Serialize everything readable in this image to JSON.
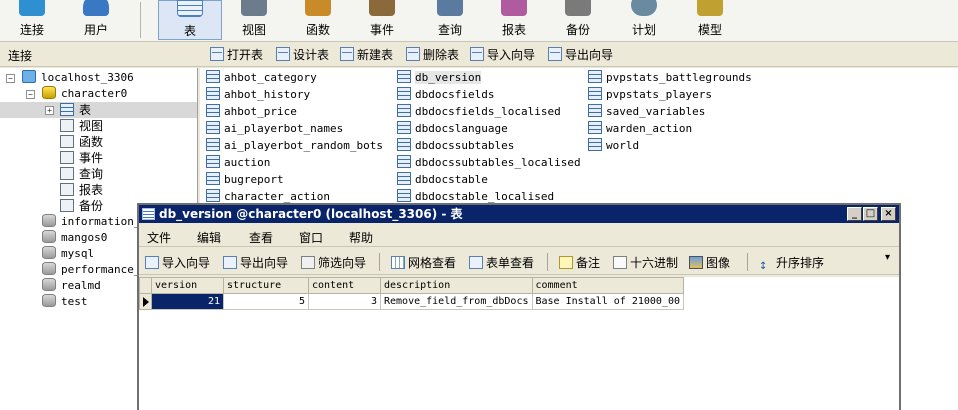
{
  "toolbar": {
    "buttons": [
      {
        "label": "连接",
        "icon": "connect-icon",
        "color": "#2f8fd0"
      },
      {
        "label": "用户",
        "icon": "user-icon",
        "color": "#3a78c4"
      },
      {
        "label": "表",
        "icon": "table-icon",
        "color": "#4a7fc0",
        "active": true
      },
      {
        "label": "视图",
        "icon": "view-icon",
        "color": "#6d7c8c"
      },
      {
        "label": "函数",
        "icon": "function-icon",
        "color": "#c98a2a"
      },
      {
        "label": "事件",
        "icon": "event-icon",
        "color": "#8a6a3a"
      },
      {
        "label": "查询",
        "icon": "query-icon",
        "color": "#5a7aa0"
      },
      {
        "label": "报表",
        "icon": "report-icon",
        "color": "#b05aa0"
      },
      {
        "label": "备份",
        "icon": "backup-icon",
        "color": "#7a7a7a"
      },
      {
        "label": "计划",
        "icon": "schedule-icon",
        "color": "#6a8aa0"
      },
      {
        "label": "模型",
        "icon": "model-icon",
        "color": "#c0a030"
      }
    ]
  },
  "subbar": {
    "connection_label": "连接",
    "actions": [
      "打开表",
      "设计表",
      "新建表",
      "删除表",
      "导入向导",
      "导出向导"
    ]
  },
  "tree": {
    "host": "localhost_3306",
    "open_db": "character0",
    "categories": [
      "表",
      "视图",
      "函数",
      "事件",
      "查询",
      "报表",
      "备份"
    ],
    "other_dbs": [
      "information_",
      "mangos0",
      "mysql",
      "performance_",
      "realmd",
      "test"
    ]
  },
  "objects": {
    "col1": [
      "ahbot_category",
      "ahbot_history",
      "ahbot_price",
      "ai_playerbot_names",
      "ai_playerbot_random_bots",
      "auction",
      "bugreport",
      "character_action"
    ],
    "col2": [
      "db_version",
      "dbdocsfields",
      "dbdocsfields_localised",
      "dbdocslanguage",
      "dbdocssubtables",
      "dbdocssubtables_localised",
      "dbdocstable",
      "dbdocstable_localised"
    ],
    "col3": [
      "pvpstats_battlegrounds",
      "pvpstats_players",
      "saved_variables",
      "warden_action",
      "world"
    ]
  },
  "window": {
    "title": "db_version @character0 (localhost_3306) - 表",
    "menu": [
      "文件",
      "编辑",
      "查看",
      "窗口",
      "帮助"
    ],
    "tools": [
      "导入向导",
      "导出向导",
      "筛选向导",
      "网格查看",
      "表单查看",
      "备注",
      "十六进制",
      "图像",
      "升序排序"
    ],
    "columns": [
      "version",
      "structure",
      "content",
      "description",
      "comment"
    ],
    "rows": [
      [
        "21",
        "5",
        "3",
        "Remove_field_from_dbDocs",
        "Base Install of 21000_00"
      ]
    ]
  }
}
